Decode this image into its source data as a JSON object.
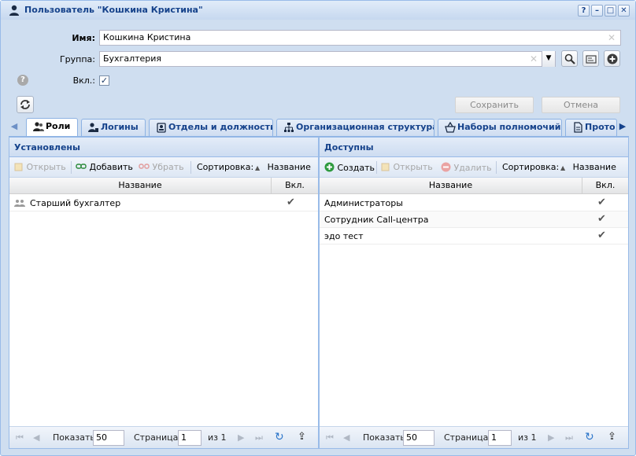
{
  "window": {
    "title": "Пользователь \"Кошкина Кристина\"",
    "tools": {
      "help": "?",
      "minimize": "–",
      "maximize": "□",
      "close": "✕"
    }
  },
  "form": {
    "name_label": "Имя:",
    "name_value": "Кошкина Кристина",
    "group_label": "Группа:",
    "group_value": "Бухгалтерия",
    "enabled_label": "Вкл.:",
    "enabled_checked": "✓",
    "save_label": "Сохранить",
    "cancel_label": "Отмена"
  },
  "tabs": [
    {
      "label": "Роли",
      "active": true
    },
    {
      "label": "Логины"
    },
    {
      "label": "Отделы и должности"
    },
    {
      "label": "Организационная структура"
    },
    {
      "label": "Наборы полномочий"
    },
    {
      "label": "Прото"
    }
  ],
  "left_panel": {
    "title": "Установлены",
    "toolbar": {
      "open": "Открыть",
      "add": "Добавить",
      "remove": "Убрать",
      "sort_label": "Сортировка:",
      "sort_field": "Название"
    },
    "columns": {
      "name": "Название",
      "enabled": "Вкл."
    },
    "rows": [
      {
        "name": "Старший бухгалтер",
        "enabled": "✔"
      }
    ],
    "pager": {
      "show_label": "Показать",
      "page_size": "50",
      "page_label": "Страница",
      "page": "1",
      "of_label": "из 1"
    }
  },
  "right_panel": {
    "title": "Доступны",
    "toolbar": {
      "create": "Создать",
      "open": "Открыть",
      "delete": "Удалить",
      "sort_label": "Сортировка:",
      "sort_field": "Название"
    },
    "columns": {
      "name": "Название",
      "enabled": "Вкл."
    },
    "rows": [
      {
        "name": "Администраторы",
        "enabled": "✔"
      },
      {
        "name": "Сотрудник Call-центра",
        "enabled": "✔"
      },
      {
        "name": "эдо тест",
        "enabled": "✔"
      }
    ],
    "pager": {
      "show_label": "Показать",
      "page_size": "50",
      "page_label": "Страница",
      "page": "1",
      "of_label": "из 1"
    }
  },
  "colors": {
    "accent": "#15428b",
    "border": "#99bbe8",
    "window_bg": "#cfdef0"
  }
}
